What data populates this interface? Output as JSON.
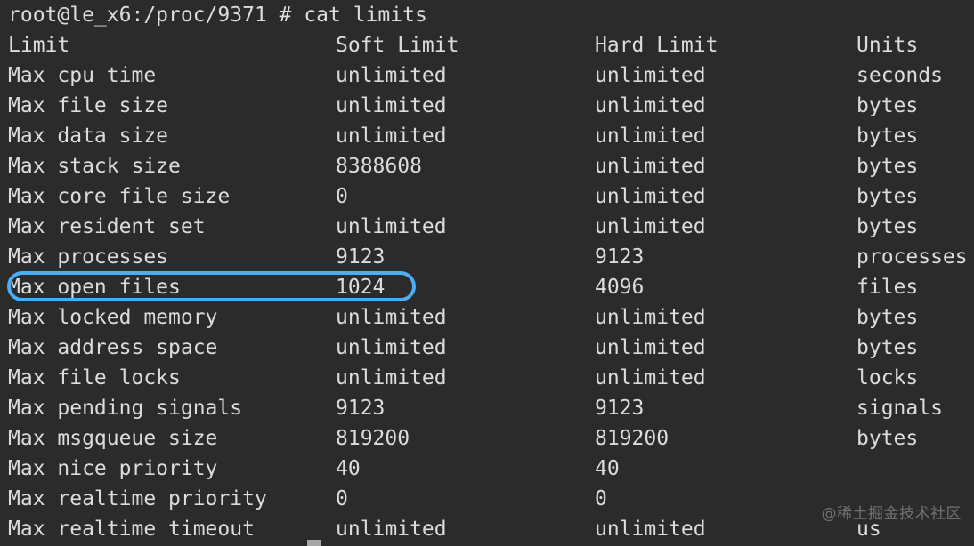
{
  "terminal": {
    "background_color": "#2b2b2b",
    "text_color": "#dcdcdc",
    "highlight_color": "#4aaef2",
    "prompt": "root@le_x6:/proc/9371 # cat limits",
    "user_host_path": "root@le_x6:/proc/9371",
    "prompt_symbol": "#",
    "command": "cat limits",
    "cursor": "block-cursor"
  },
  "table": {
    "headers": {
      "name": "Limit",
      "soft": "Soft Limit",
      "hard": "Hard Limit",
      "units": "Units"
    },
    "rows": [
      {
        "name": "Max cpu time",
        "soft": "unlimited",
        "hard": "unlimited",
        "units": "seconds",
        "highlighted": false
      },
      {
        "name": "Max file size",
        "soft": "unlimited",
        "hard": "unlimited",
        "units": "bytes",
        "highlighted": false
      },
      {
        "name": "Max data size",
        "soft": "unlimited",
        "hard": "unlimited",
        "units": "bytes",
        "highlighted": false
      },
      {
        "name": "Max stack size",
        "soft": "8388608",
        "hard": "unlimited",
        "units": "bytes",
        "highlighted": false
      },
      {
        "name": "Max core file size",
        "soft": "0",
        "hard": "unlimited",
        "units": "bytes",
        "highlighted": false
      },
      {
        "name": "Max resident set",
        "soft": "unlimited",
        "hard": "unlimited",
        "units": "bytes",
        "highlighted": false
      },
      {
        "name": "Max processes",
        "soft": "9123",
        "hard": "9123",
        "units": "processes",
        "highlighted": false
      },
      {
        "name": "Max open files",
        "soft": "1024",
        "hard": "4096",
        "units": "files",
        "highlighted": true
      },
      {
        "name": "Max locked memory",
        "soft": "unlimited",
        "hard": "unlimited",
        "units": "bytes",
        "highlighted": false
      },
      {
        "name": "Max address space",
        "soft": "unlimited",
        "hard": "unlimited",
        "units": "bytes",
        "highlighted": false
      },
      {
        "name": "Max file locks",
        "soft": "unlimited",
        "hard": "unlimited",
        "units": "locks",
        "highlighted": false
      },
      {
        "name": "Max pending signals",
        "soft": "9123",
        "hard": "9123",
        "units": "signals",
        "highlighted": false
      },
      {
        "name": "Max msgqueue size",
        "soft": "819200",
        "hard": "819200",
        "units": "bytes",
        "highlighted": false
      },
      {
        "name": "Max nice priority",
        "soft": "40",
        "hard": "40",
        "units": "",
        "highlighted": false
      },
      {
        "name": "Max realtime priority",
        "soft": "0",
        "hard": "0",
        "units": "",
        "highlighted": false
      },
      {
        "name": "Max realtime timeout",
        "soft": "unlimited",
        "hard": "unlimited",
        "units": "us",
        "highlighted": false
      }
    ]
  },
  "watermark": {
    "text": "@稀土掘金技术社区"
  }
}
